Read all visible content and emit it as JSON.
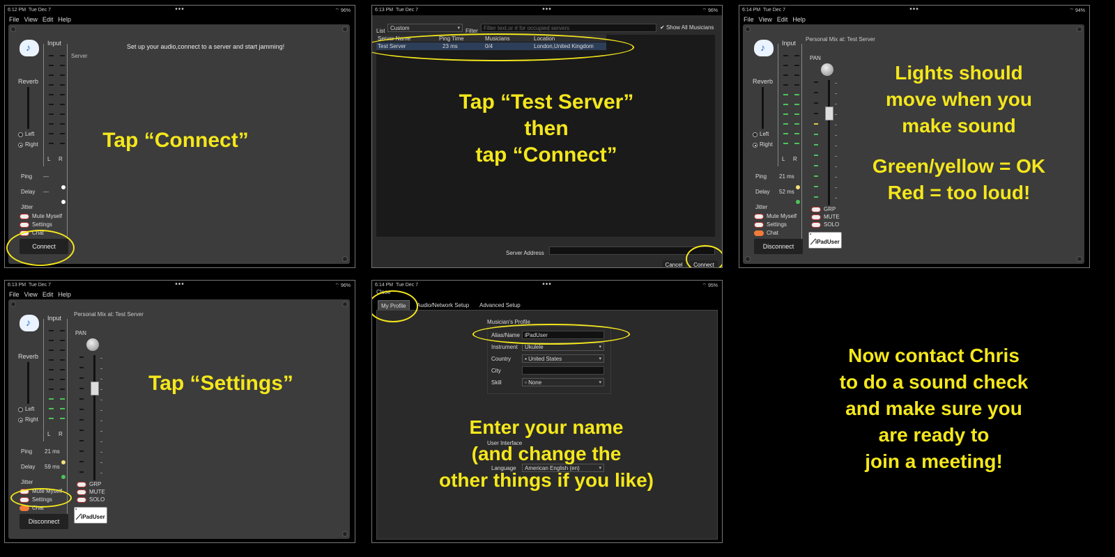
{
  "panels": {
    "p1": {
      "status": {
        "time": "6:12 PM",
        "date": "Tue Dec 7",
        "battery": "96%"
      },
      "menu": [
        "File",
        "View",
        "Edit",
        "Help"
      ],
      "input_label": "Input",
      "reverb_label": "Reverb",
      "left": "Left",
      "right": "Right",
      "l": "L",
      "r": "R",
      "ping_label": "Ping",
      "ping_value": "---",
      "delay_label": "Delay",
      "delay_value": "---",
      "jitter_label": "Jitter",
      "mute_myself": "Mute Myself",
      "settings": "Settings",
      "chat": "Chat",
      "connect_button": "Connect",
      "setup_message": "Set up your audio,connect to a server and start jamming!",
      "server_label": "Server",
      "callout": "Tap “Connect”"
    },
    "p2": {
      "status": {
        "time": "6:13 PM",
        "date": "Tue Dec 7",
        "battery": "96%"
      },
      "list_label": "List",
      "list_value": "Custom",
      "filter_label": "Filter",
      "filter_placeholder": "Filter text,or # for occupied servers",
      "show_all": "Show All Musicians",
      "columns": [
        "Server Name",
        "Ping Time",
        "Musicians",
        "Location"
      ],
      "row": [
        "Test Server",
        "23 ms",
        "0/4",
        "London,United Kingdom"
      ],
      "server_address_label": "Server Address",
      "cancel": "Cancel",
      "connect": "Connect",
      "callout": [
        "Tap “Test Server”",
        "then",
        "tap “Connect”"
      ]
    },
    "p3": {
      "status": {
        "time": "6:14 PM",
        "date": "Tue Dec 7",
        "battery": "94%"
      },
      "menu": [
        "File",
        "View",
        "Edit",
        "Help"
      ],
      "input_label": "Input",
      "reverb_label": "Reverb",
      "left": "Left",
      "right": "Right",
      "l": "L",
      "r": "R",
      "ping_label": "Ping",
      "ping_value": "21 ms",
      "delay_label": "Delay",
      "delay_value": "52 ms",
      "jitter_label": "Jitter",
      "mute_myself": "Mute Myself",
      "settings": "Settings",
      "chat": "Chat",
      "disconnect": "Disconnect",
      "personal_mix": "Personal Mix at: Test Server",
      "pan": "PAN",
      "grp": "GRP",
      "mute": "MUTE",
      "solo": "SOLO",
      "user_badge": "iPadUser",
      "callout": [
        "Lights should",
        "move when you",
        "make sound",
        "",
        "Green/yellow = OK",
        "Red = too loud!"
      ]
    },
    "p4": {
      "status": {
        "time": "6:13 PM",
        "date": "Tue Dec 7",
        "battery": "96%"
      },
      "menu": [
        "File",
        "View",
        "Edit",
        "Help"
      ],
      "input_label": "Input",
      "reverb_label": "Reverb",
      "left": "Left",
      "right": "Right",
      "l": "L",
      "r": "R",
      "ping_label": "Ping",
      "ping_value": "21 ms",
      "delay_label": "Delay",
      "delay_value": "59 ms",
      "jitter_label": "Jitter",
      "mute_myself": "Mute Myself",
      "settings": "Settings",
      "chat": "Chat",
      "disconnect": "Disconnect",
      "personal_mix": "Personal Mix at: Test Server",
      "pan": "PAN",
      "grp": "GRP",
      "mute": "MUTE",
      "solo": "SOLO",
      "user_badge": "iPadUser",
      "callout": "Tap “Settings”"
    },
    "p5": {
      "status": {
        "time": "6:14 PM",
        "date": "Tue Dec 7",
        "battery": "95%"
      },
      "close": "Close",
      "tabs": [
        "My Profile",
        "Audio/Network Setup",
        "Advanced Setup"
      ],
      "section_profile": "Musician's Profile",
      "alias_label": "Alias/Name",
      "alias_value": "iPadUser",
      "instrument_label": "Instrument",
      "instrument_value": "Ukulele",
      "country_label": "Country",
      "country_value": "United States",
      "city_label": "City",
      "city_value": "",
      "skill_label": "Skill",
      "skill_value": "None",
      "section_ui": "User Interface",
      "language_label": "Language",
      "language_value": "American English (en)",
      "callout": [
        "Enter your name",
        "(and change the",
        "other things if you like)"
      ]
    },
    "p6": {
      "callout": [
        "Now contact Chris",
        "to do a sound check",
        "and make sure you",
        "are ready to",
        "join a meeting!"
      ]
    }
  },
  "colors": {
    "callout": "#f4e71c",
    "meter_green": "#4cc45a",
    "meter_yellow": "#e0cc55",
    "window": "#3c3c3c"
  }
}
